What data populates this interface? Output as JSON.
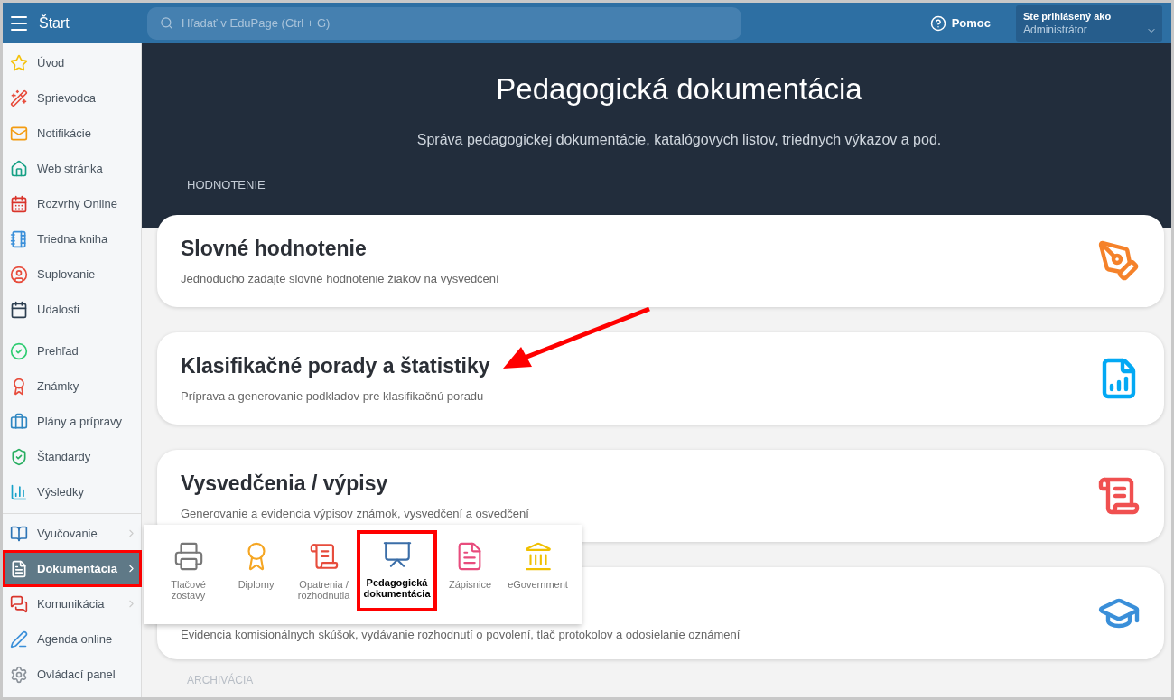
{
  "topbar": {
    "title": "Štart",
    "search": {
      "placeholder": "Hľadať v EduPage (Ctrl + G)"
    },
    "help": "Pomoc",
    "account": {
      "label": "Ste prihlásený ako",
      "role": "Administrátor"
    }
  },
  "sidebar": {
    "groups": [
      {
        "items": [
          {
            "label": "Úvod",
            "selected": false,
            "submenu": false
          },
          {
            "label": "Sprievodca",
            "selected": false,
            "submenu": false
          },
          {
            "label": "Notifikácie",
            "selected": false,
            "submenu": false
          },
          {
            "label": "Web stránka",
            "selected": false,
            "submenu": false
          },
          {
            "label": "Rozvrhy Online",
            "selected": false,
            "submenu": false
          },
          {
            "label": "Triedna kniha",
            "selected": false,
            "submenu": false
          },
          {
            "label": "Suplovanie",
            "selected": false,
            "submenu": false
          },
          {
            "label": "Udalosti",
            "selected": false,
            "submenu": false
          }
        ]
      },
      {
        "items": [
          {
            "label": "Prehľad",
            "selected": false,
            "submenu": false
          },
          {
            "label": "Známky",
            "selected": false,
            "submenu": false
          },
          {
            "label": "Plány a prípravy",
            "selected": false,
            "submenu": false
          },
          {
            "label": "Štandardy",
            "selected": false,
            "submenu": false
          },
          {
            "label": "Výsledky",
            "selected": false,
            "submenu": false
          }
        ]
      },
      {
        "items": [
          {
            "label": "Vyučovanie",
            "selected": false,
            "submenu": true
          },
          {
            "label": "Dokumentácia",
            "selected": true,
            "submenu": true
          },
          {
            "label": "Komunikácia",
            "selected": false,
            "submenu": true
          },
          {
            "label": "Agenda online",
            "selected": false,
            "submenu": false
          },
          {
            "label": "Ovládací panel",
            "selected": false,
            "submenu": false
          }
        ]
      }
    ]
  },
  "hero": {
    "title": "Pedagogická dokumentácia",
    "subtitle": "Správa pedagogickej dokumentácie, katalógovych listov, triednych výkazov a pod."
  },
  "sections": [
    {
      "heading": "HODNOTENIE",
      "cards": [
        {
          "title": "Slovné hodnotenie",
          "description": "Jednoducho zadajte slovné hodnotenie žiakov na vysvedčení"
        },
        {
          "title": "Klasifikačné porady a štatistiky",
          "description": "Príprava a generovanie podkladov pre klasifikačnú poradu"
        },
        {
          "title": "Vysvedčenia / výpisy",
          "description": "Generovanie a evidencia výpisov známok, vysvedčení a osvedčení"
        },
        {
          "description": "Evidencia komisionálnych skúšok, vydávanie rozhodnutí o povolení, tlač protokolov a odosielanie oznámení"
        }
      ]
    },
    {
      "heading": "ARCHIVÁCIA"
    }
  ],
  "submenu": [
    {
      "label": "Tlačové zostavy",
      "selected": false
    },
    {
      "label": "Diplomy",
      "selected": false
    },
    {
      "label": "Opatrenia / rozhodnutia",
      "selected": false
    },
    {
      "label": "Pedagogická dokumentácia",
      "selected": true
    },
    {
      "label": "Zápisnice",
      "selected": false
    },
    {
      "label": "eGovernment",
      "selected": false
    }
  ]
}
